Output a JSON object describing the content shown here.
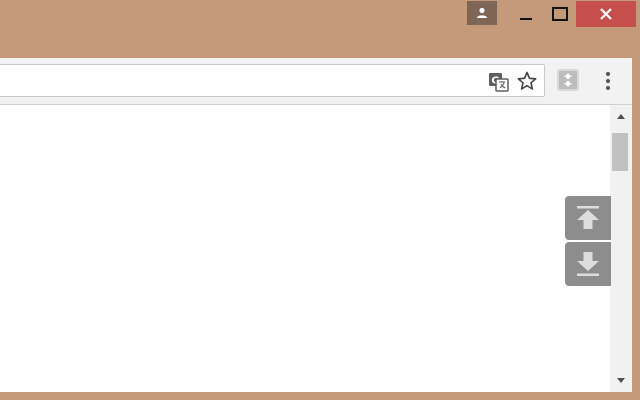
{
  "window": {
    "controls": [
      "profile",
      "minimize",
      "maximize",
      "close"
    ]
  },
  "toolbar": {
    "address_value": "",
    "icons": [
      "translate-icon",
      "star-icon",
      "extension-icon",
      "menu-icon"
    ]
  },
  "page": {
    "scroll_buttons": [
      "scroll-to-top",
      "scroll-to-bottom"
    ]
  },
  "colors": {
    "frame": "#c49a7a",
    "close": "#c7504f",
    "profile": "#7f6555",
    "float_button": "#8d8d8d"
  }
}
